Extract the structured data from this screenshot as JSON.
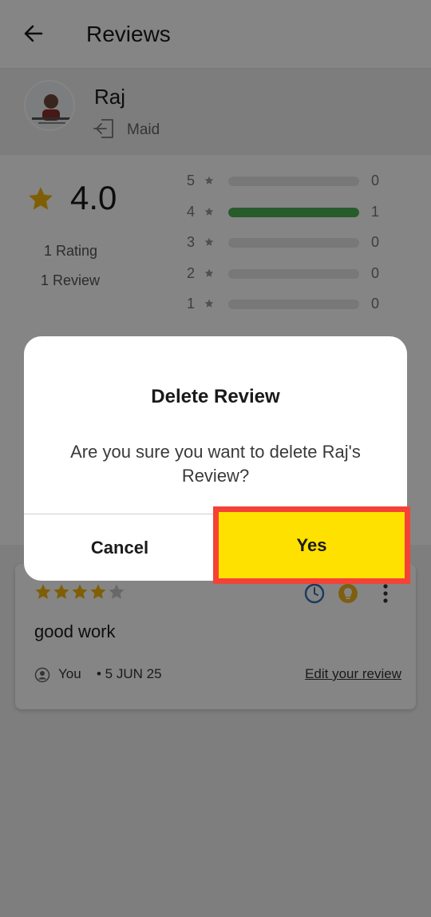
{
  "header": {
    "title": "Reviews"
  },
  "profile": {
    "name": "Raj",
    "role": "Maid"
  },
  "summary": {
    "average": "4.0",
    "ratings_count": "1 Rating",
    "reviews_count": "1 Review",
    "distribution": [
      {
        "stars": "5",
        "count": "0",
        "fraction": 0
      },
      {
        "stars": "4",
        "count": "1",
        "fraction": 1
      },
      {
        "stars": "3",
        "count": "0",
        "fraction": 0
      },
      {
        "stars": "2",
        "count": "0",
        "fraction": 0
      },
      {
        "stars": "1",
        "count": "0",
        "fraction": 0
      }
    ]
  },
  "review": {
    "rating": 4,
    "text": "good work",
    "author": "You",
    "date": "• 5 JUN 25",
    "edit_label": "Edit your review"
  },
  "dialog": {
    "title": "Delete Review",
    "message": "Are you sure you want to delete Raj's Review?",
    "cancel_label": "Cancel",
    "confirm_label": "Yes"
  },
  "colors": {
    "star": "#f5b40a",
    "bar_fill": "#4caf50",
    "confirm_bg": "#ffe100",
    "highlight_border": "#f44336"
  }
}
